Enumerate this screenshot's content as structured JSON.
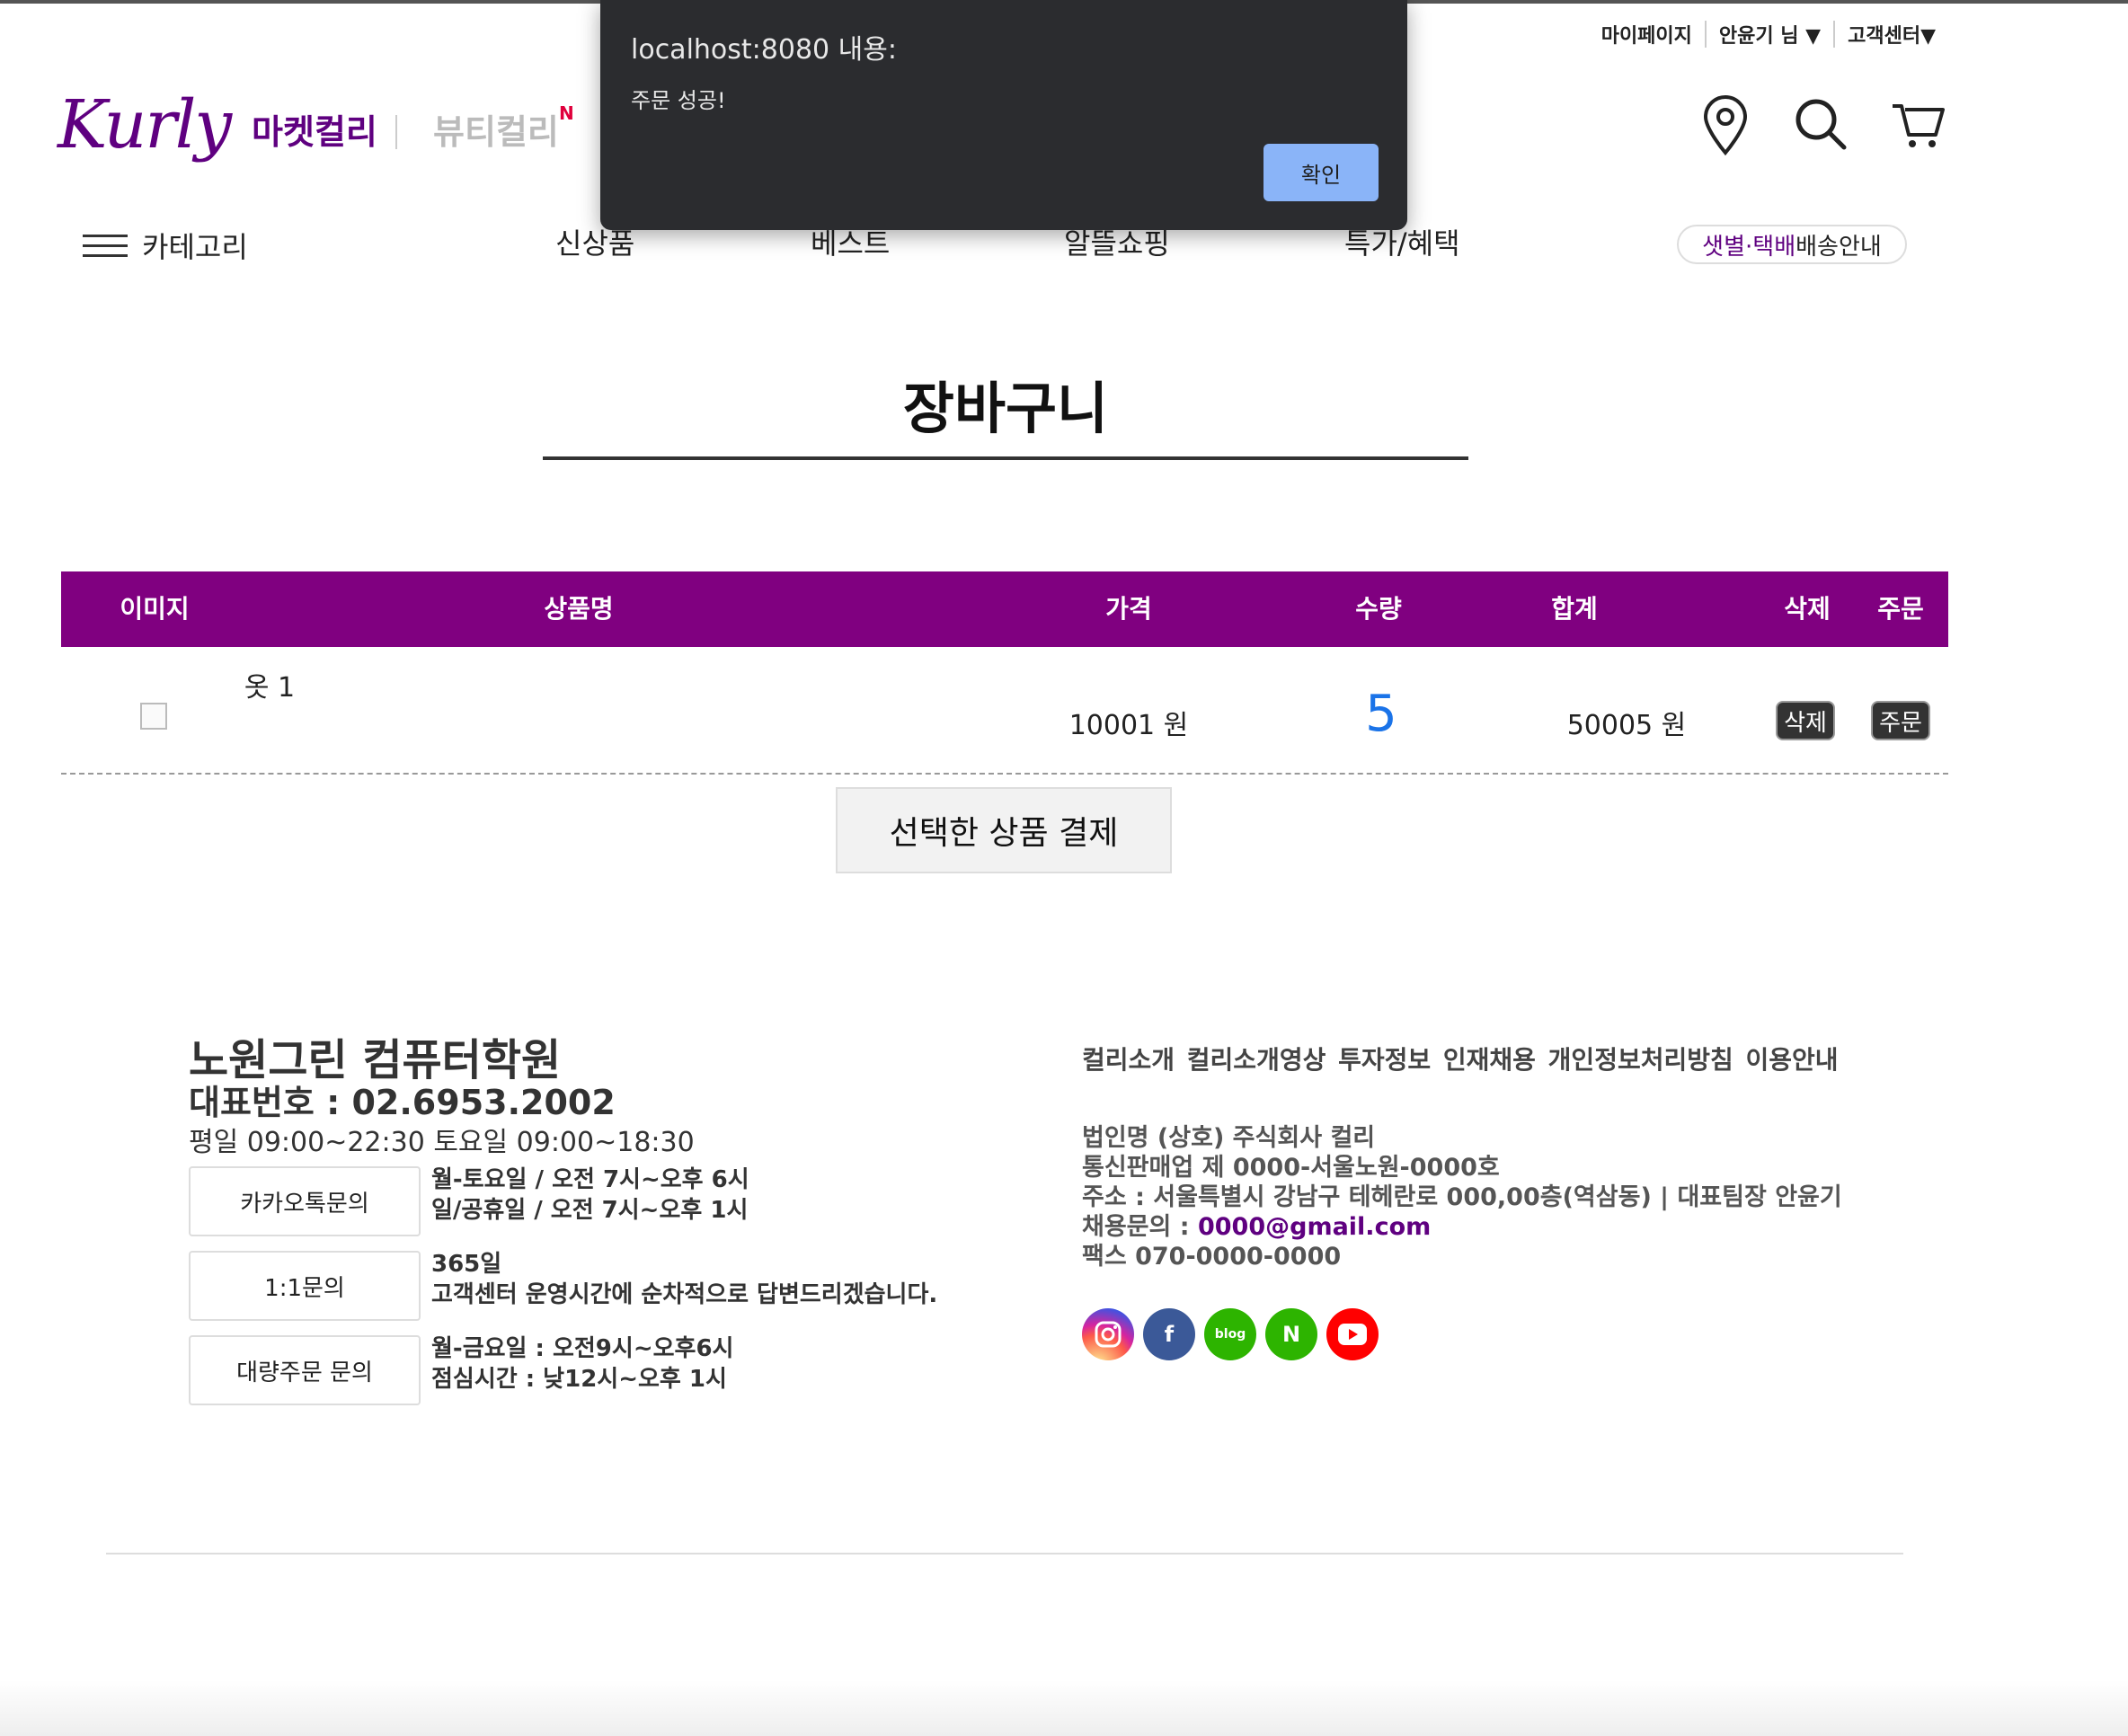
{
  "dialog": {
    "title": "localhost:8080 내용:",
    "message": "주문 성공!",
    "ok_label": "확인"
  },
  "util_nav": {
    "mypage": "마이페이지",
    "user": "안윤기 님 ▼",
    "support": "고객센터▼"
  },
  "header": {
    "logo": "Kurly",
    "market": "마켓컬리",
    "beauty": "뷰티컬리",
    "beauty_badge": "N",
    "icons": [
      "location-pin-icon",
      "search-icon",
      "cart-icon"
    ]
  },
  "nav": {
    "category": "카테고리",
    "items": [
      "신상품",
      "베스트",
      "알뜰쇼핑",
      "특가/혜택"
    ],
    "delivery_highlight": "샛별·택배",
    "delivery_rest": " 배송안내"
  },
  "page": {
    "title": "장바구니"
  },
  "cart": {
    "headers": {
      "image": "이미지",
      "name": "상품명",
      "price": "가격",
      "qty": "수량",
      "total": "합계",
      "delete": "삭제",
      "order": "주문"
    },
    "rows": [
      {
        "name": "옷 1",
        "price": "10001 원",
        "qty": "5",
        "total": "50005 원",
        "delete_label": "삭제",
        "order_label": "주문"
      }
    ],
    "pay_button": "선택한 상품 결제"
  },
  "footer": {
    "company": "노원그린 컴퓨터학원",
    "phone": "대표번호 : 02.6953.2002",
    "hours": "평일 09:00~22:30 토요일 09:00~18:30",
    "contacts": [
      {
        "label": "카카오톡문의",
        "line1": "월-토요일 / 오전 7시~오후 6시",
        "line2": "일/공휴일 / 오전 7시~오후 1시"
      },
      {
        "label": "1:1문의",
        "line1": "365일",
        "line2": "고객센터 운영시간에 순차적으로 답변드리겠습니다."
      },
      {
        "label": "대량주문 문의",
        "line1": "월-금요일 : 오전9시~오후6시",
        "line2": "점심시간 : 낮12시~오후 1시"
      }
    ],
    "links": "컬리소개 컬리소개영상 투자정보 인재채용 개인정보처리방침 이용안내",
    "info": {
      "corp": "법인명 (상호) 주식회사 컬리",
      "reg": "통신판매업 제 0000-서울노원-0000호",
      "addr": "주소 : 서울특별시 강남구 테헤란로 000,00층(역삼동) | 대표팀장 안윤기",
      "recruit_label": "채용문의 : ",
      "recruit_email": "0000@gmail.com",
      "fax": "팩스 070-0000-0000"
    },
    "social": {
      "facebook": "f",
      "blog": "blog",
      "post": "N"
    }
  },
  "colors": {
    "brand": "#5f0080",
    "table_header": "#800080",
    "qty": "#1a73e8",
    "dialog_bg": "#2b2c2f",
    "dialog_button": "#8ab4f8"
  }
}
